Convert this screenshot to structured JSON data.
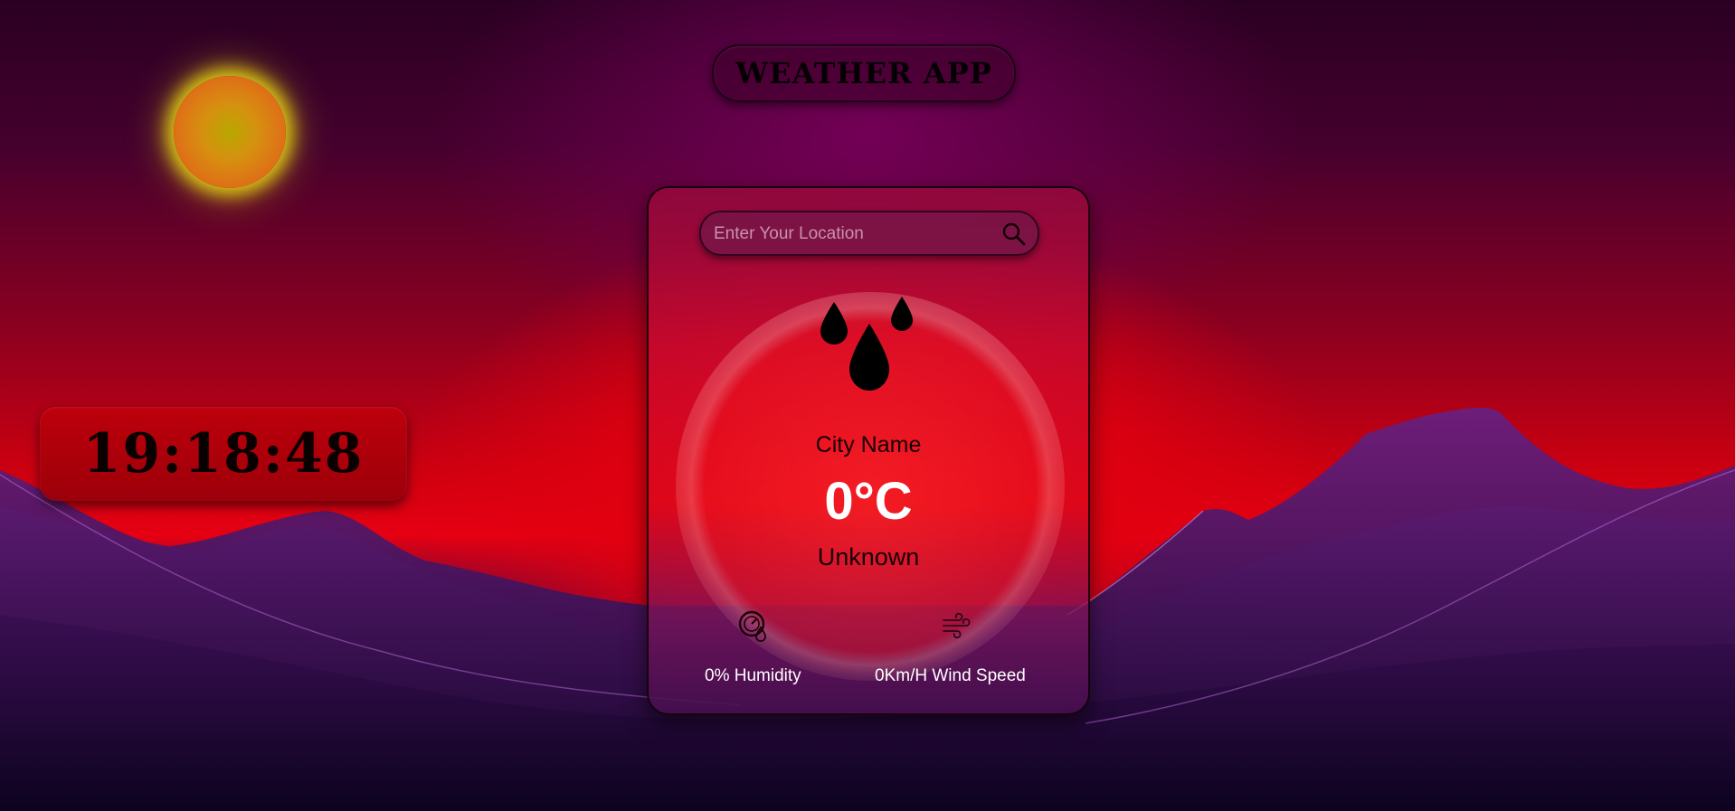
{
  "header": {
    "title": "WEATHER APP"
  },
  "clock": {
    "time": "19:18:48"
  },
  "search": {
    "placeholder": "Enter Your Location",
    "value": "",
    "button_icon": "search-icon"
  },
  "weather": {
    "icon": "rain-drops-icon",
    "city": "City Name",
    "temperature": "0°C",
    "condition": "Unknown"
  },
  "stats": {
    "humidity": {
      "icon": "humidity-gauge-icon",
      "label": "0% Humidity"
    },
    "wind": {
      "icon": "wind-icon",
      "label": "0Km/H Wind Speed"
    }
  },
  "decor": {
    "sun_icon": "sun-icon",
    "background": "red-sunset-mountains"
  },
  "colors": {
    "sun": "#e06a18",
    "sun_glow": "#e8dc14",
    "sky_red": "#e60012",
    "mountain_purple": "#4a1660"
  }
}
